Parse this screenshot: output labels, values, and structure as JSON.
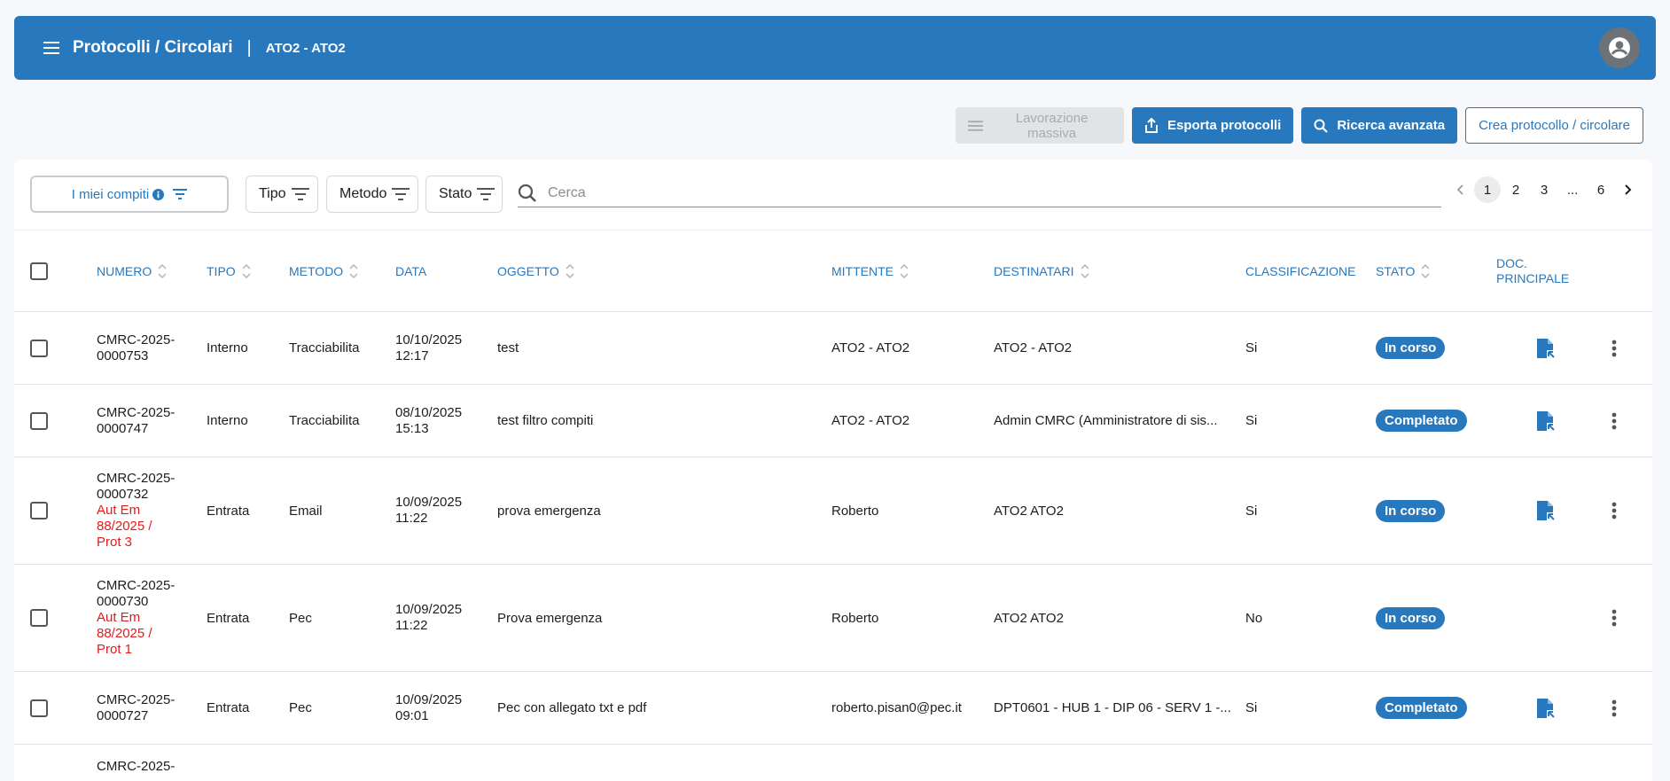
{
  "appbar": {
    "title": "Protocolli / Circolari",
    "separator": "|",
    "org": "ATO2 - ATO2",
    "menu_icon": "hamburger-icon",
    "avatar_icon": "account-circle-icon"
  },
  "actions": {
    "bulk_label": "Lavorazione massiva",
    "export_label": "Esporta protocolli",
    "advanced_search_label": "Ricerca avanzata",
    "create_label": "Crea protocollo / circolare"
  },
  "filters": {
    "my_tasks_label": "I miei compiti",
    "tipo_label": "Tipo",
    "metodo_label": "Metodo",
    "stato_label": "Stato",
    "search_placeholder": "Cerca"
  },
  "pagination": {
    "pages": [
      "1",
      "2",
      "3",
      "...",
      "6"
    ],
    "active": "1"
  },
  "table": {
    "headers": {
      "numero": "NUMERO",
      "tipo": "TIPO",
      "metodo": "METODO",
      "data": "DATA",
      "oggetto": "OGGETTO",
      "mittente": "MITTENTE",
      "destinatari": "DESTINATARI",
      "classificazione": "CLASSIFICAZIONE",
      "stato": "STATO",
      "doc_line1": "DOC.",
      "doc_line2": "PRINCIPALE"
    },
    "rows": [
      {
        "numero1": "CMRC-2025-",
        "numero2": "0000753",
        "extra": [],
        "tipo": "Interno",
        "metodo": "Tracciabilita",
        "data1": "10/10/2025",
        "data2": "12:17",
        "oggetto": "test",
        "mittente": "ATO2 - ATO2",
        "destinatari": "ATO2 - ATO2",
        "classificazione": "Si",
        "stato": "In corso",
        "has_doc": true
      },
      {
        "numero1": "CMRC-2025-",
        "numero2": "0000747",
        "extra": [],
        "tipo": "Interno",
        "metodo": "Tracciabilita",
        "data1": "08/10/2025",
        "data2": "15:13",
        "oggetto": "test filtro compiti",
        "mittente": "ATO2 - ATO2",
        "destinatari": "Admin CMRC (Amministratore di sis...",
        "classificazione": "Si",
        "stato": "Completato",
        "has_doc": true
      },
      {
        "numero1": "CMRC-2025-",
        "numero2": "0000732",
        "extra": [
          "Aut Em",
          "88/2025 /",
          "Prot 3"
        ],
        "tipo": "Entrata",
        "metodo": "Email",
        "data1": "10/09/2025",
        "data2": "11:22",
        "oggetto": "prova emergenza",
        "mittente": "Roberto",
        "destinatari": "ATO2 ATO2",
        "classificazione": "Si",
        "stato": "In corso",
        "has_doc": true
      },
      {
        "numero1": "CMRC-2025-",
        "numero2": "0000730",
        "extra": [
          "Aut Em",
          "88/2025 /",
          "Prot 1"
        ],
        "tipo": "Entrata",
        "metodo": "Pec",
        "data1": "10/09/2025",
        "data2": "11:22",
        "oggetto": "Prova emergenza",
        "mittente": "Roberto",
        "destinatari": "ATO2 ATO2",
        "classificazione": "No",
        "stato": "In corso",
        "has_doc": false
      },
      {
        "numero1": "CMRC-2025-",
        "numero2": "0000727",
        "extra": [],
        "tipo": "Entrata",
        "metodo": "Pec",
        "data1": "10/09/2025",
        "data2": "09:01",
        "oggetto": "Pec con allegato txt e pdf",
        "mittente": "roberto.pisan0@pec.it",
        "destinatari": "DPT0601 - HUB 1 - DIP 06 - SERV 1 -...",
        "classificazione": "Si",
        "stato": "Completato",
        "has_doc": true
      },
      {
        "numero1": "CMRC-2025-",
        "numero2": "",
        "extra": [],
        "tipo": "",
        "metodo": "",
        "data1": "",
        "data2": "",
        "oggetto": "",
        "mittente": "",
        "destinatari": "",
        "classificazione": "",
        "stato": "",
        "has_doc": false
      }
    ]
  },
  "colors": {
    "primary": "#2878bd",
    "accent_red": "#e21b1b",
    "disabled_bg": "#e2e3e5"
  }
}
